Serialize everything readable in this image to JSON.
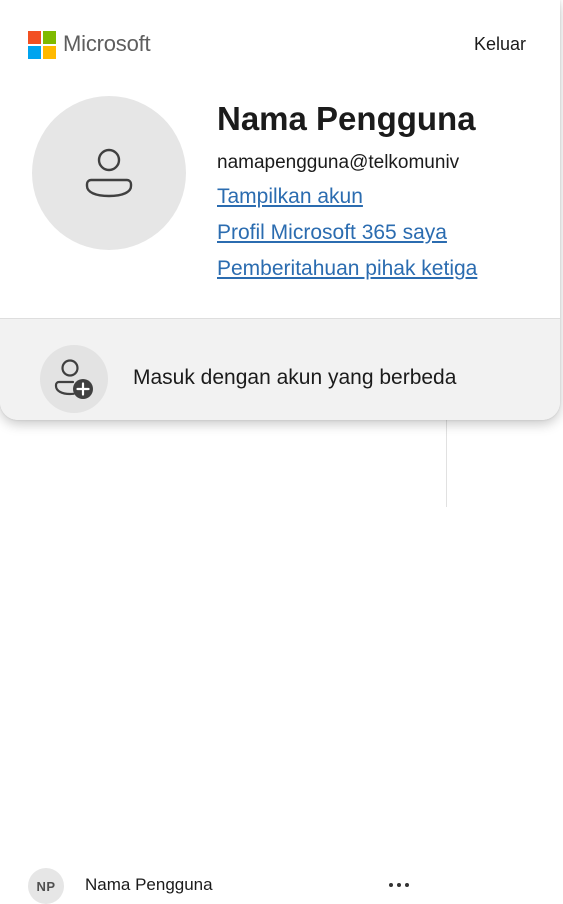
{
  "brand": {
    "name": "Microsoft",
    "logo_colors": [
      "#f25022",
      "#7fba00",
      "#00a4ef",
      "#ffb900"
    ]
  },
  "header": {
    "signout_label": "Keluar"
  },
  "account": {
    "display_name": "Nama Pengguna",
    "email": "namapengguna@telkomuniv",
    "avatar_icon": "person-icon"
  },
  "links": [
    {
      "label": "Tampilkan akun"
    },
    {
      "label": "Profil Microsoft 365 saya"
    },
    {
      "label": "Pemberitahuan pihak ketiga"
    }
  ],
  "other_account": {
    "label": "Masuk dengan akun yang berbeda",
    "icon": "person-add-icon"
  },
  "background_list": {
    "initials": "NP",
    "name": "Nama Pengguna",
    "more_icon": "more-horizontal-icon"
  },
  "colors": {
    "link": "#2b6cb0",
    "row_bg": "#f2f2f2",
    "avatar_bg": "#e6e6e6"
  }
}
